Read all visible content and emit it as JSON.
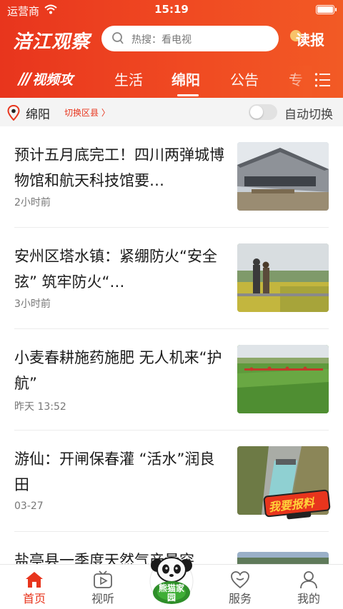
{
  "status_bar": {
    "carrier": "运营商",
    "time": "15:19"
  },
  "header": {
    "logo_text": "涪江观察",
    "search_placeholder": "热搜：看电视",
    "read_paper_label": "读报",
    "tabs": [
      {
        "label": "视频攻"
      },
      {
        "label": "生活"
      },
      {
        "label": "绵阳",
        "active": true
      },
      {
        "label": "公告"
      },
      {
        "label": "专"
      }
    ]
  },
  "location_bar": {
    "city": "绵阳",
    "switch_label": "切换区县 〉",
    "auto_switch_label": "自动切换",
    "auto_switch_on": false
  },
  "news": [
    {
      "title": "预计五月底完工！四川两弹城博物馆和航天科技馆要…",
      "time": "2小时前"
    },
    {
      "title": "安州区塔水镇：紧绷防火“安全弦” 筑牢防火“…",
      "time": "3小时前"
    },
    {
      "title": "小麦春耕施药施肥 无人机来“护航”",
      "time": "昨天 13:52"
    },
    {
      "title": "游仙：开闸保春灌 “活水”润良田",
      "time": "03-27",
      "badge": "我要报料"
    },
    {
      "title": "盐亭县一季度天然气产量突",
      "time": ""
    }
  ],
  "bottom_nav": [
    {
      "label": "首页",
      "active": true
    },
    {
      "label": "视听"
    },
    {
      "label": "熊猫家园"
    },
    {
      "label": "服务"
    },
    {
      "label": "我的"
    }
  ],
  "colors": {
    "brand_red": "#e8351d",
    "accent_orange": "#f25a25"
  }
}
